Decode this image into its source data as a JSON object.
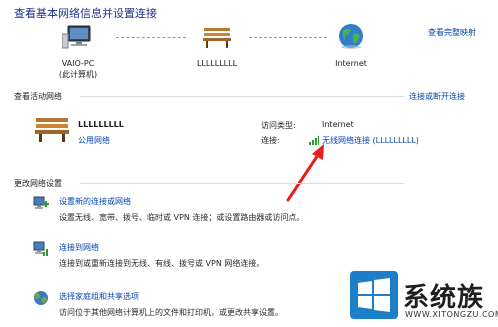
{
  "header": {
    "title": "查看基本网络信息并设置连接",
    "full_map_link": "查看完整映射"
  },
  "map": {
    "computer_name": "VAIO-PC",
    "computer_sub": "(此计算机)",
    "network_name": "LLLLLLLLL",
    "internet_label": "Internet"
  },
  "active": {
    "section_label": "查看活动网络",
    "connect_link": "连接或断开连接",
    "network_name": "LLLLLLLLL",
    "network_type": "公用网络",
    "access_type_label": "访问类型:",
    "access_type_value": "Internet",
    "connection_label": "连接:",
    "connection_value": "无线网络连接 (LLLLLLLLL)"
  },
  "change": {
    "section_label": "更改网络设置",
    "items": [
      {
        "title": "设置新的连接或网络",
        "desc": "设置无线、宽带、拨号、临时或 VPN 连接；或设置路由器或访问点。",
        "icon": "new-connection-icon"
      },
      {
        "title": "连接到网络",
        "desc": "连接到或重新连接到无线、有线、拨号或 VPN 网络连接。",
        "icon": "connect-network-icon"
      },
      {
        "title": "选择家庭组和共享选项",
        "desc": "访问位于其他网络计算机上的文件和打印机，或更改共享设置。",
        "icon": "homegroup-icon"
      }
    ]
  },
  "watermark": {
    "brand": "系统族",
    "url": "WWW.XITONGZU.COM"
  },
  "colors": {
    "title_blue": "#1e3287",
    "link_blue": "#0645ad",
    "arrow_red": "#e8201c",
    "logo_blue": "#1c7fc8"
  }
}
